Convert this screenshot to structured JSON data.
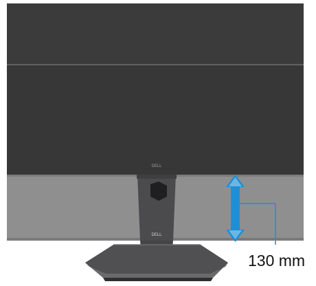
{
  "product": {
    "bezel_logo": "DELL",
    "stand_logo": "DELL"
  },
  "annotation": {
    "height_adjust_label": "130 mm"
  },
  "colors": {
    "upper_panel": "#3a3a3b",
    "lower_panel": "#8e8e8f",
    "stand": "#4a4a4c",
    "arrow": "#1e8fd6"
  },
  "icons": [
    "double-arrow-icon",
    "cable-hole-icon"
  ]
}
